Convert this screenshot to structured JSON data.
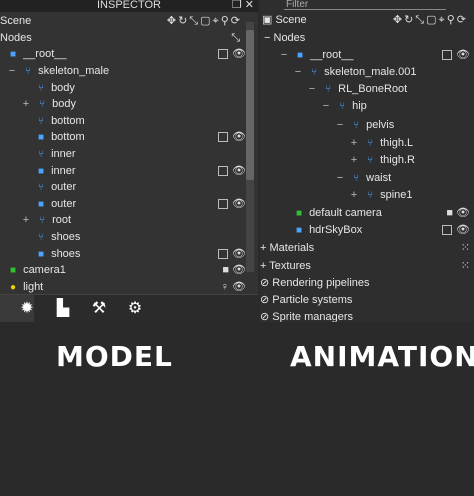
{
  "left": {
    "title": "INSPECTOR",
    "scene_label": "Scene",
    "nodes_label": "Nodes",
    "rows": [
      {
        "label": "__root__",
        "icon": "cube"
      },
      {
        "label": "skeleton_male",
        "icon": "bone"
      },
      {
        "label": "body",
        "icon": "bone"
      },
      {
        "label": "body",
        "icon": "bone",
        "expand": "+"
      },
      {
        "label": "bottom",
        "icon": "bone"
      },
      {
        "label": "bottom",
        "icon": "cube"
      },
      {
        "label": "inner",
        "icon": "bone"
      },
      {
        "label": "inner",
        "icon": "cube"
      },
      {
        "label": "outer",
        "icon": "bone"
      },
      {
        "label": "outer",
        "icon": "cube"
      },
      {
        "label": "root",
        "icon": "bone",
        "expand": "+"
      },
      {
        "label": "shoes",
        "icon": "bone"
      },
      {
        "label": "shoes",
        "icon": "cube"
      },
      {
        "label": "camera1",
        "icon": "camera"
      },
      {
        "label": "light",
        "icon": "light"
      }
    ]
  },
  "right": {
    "filter_placeholder": "Filter",
    "scene_label": "Scene",
    "nodes_label": "Nodes",
    "rows": [
      {
        "label": "__root__",
        "icon": "cube"
      },
      {
        "label": "skeleton_male.001",
        "icon": "bone"
      },
      {
        "label": "RL_BoneRoot",
        "icon": "bone"
      },
      {
        "label": "hip",
        "icon": "bone"
      },
      {
        "label": "pelvis",
        "icon": "bone"
      },
      {
        "label": "thigh.L",
        "icon": "bone",
        "expand": "+"
      },
      {
        "label": "thigh.R",
        "icon": "bone",
        "expand": "+"
      },
      {
        "label": "waist",
        "icon": "bone"
      },
      {
        "label": "spine1",
        "icon": "bone",
        "expand": "+"
      },
      {
        "label": "default camera",
        "icon": "camera"
      },
      {
        "label": "hdrSkyBox",
        "icon": "cube"
      }
    ],
    "sections": [
      {
        "label": "Materials"
      },
      {
        "label": "Textures"
      },
      {
        "label": "Rendering pipelines"
      },
      {
        "label": "Particle systems"
      },
      {
        "label": "Sprite managers"
      }
    ]
  },
  "captions": {
    "left": "MODEL",
    "right": "ANIMATION"
  }
}
